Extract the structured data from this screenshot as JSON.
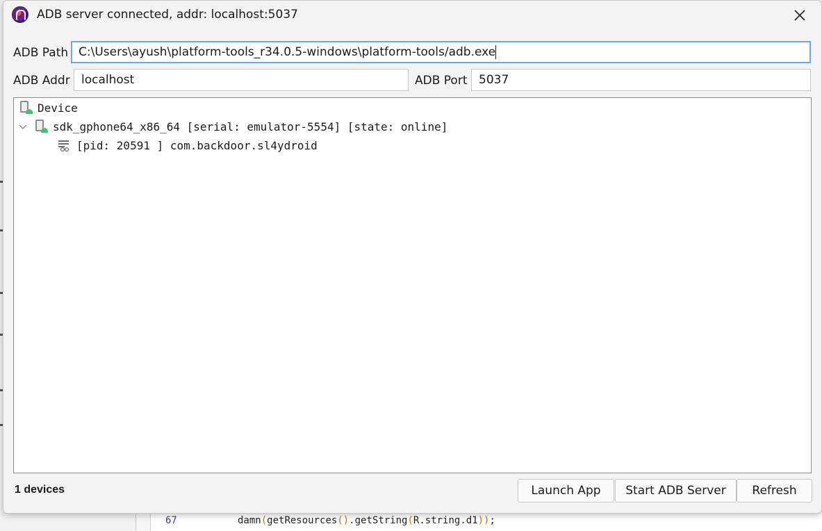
{
  "window": {
    "title": "ADB server connected, addr: localhost:5037"
  },
  "form": {
    "adb_path_label": "ADB Path",
    "adb_path_value": "C:\\Users\\ayush\\platform-tools_r34.0.5-windows\\platform-tools/adb.exe",
    "adb_addr_label": "ADB Addr",
    "adb_addr_value": "localhost",
    "adb_port_label": "ADB Port",
    "adb_port_value": "5037"
  },
  "tree": {
    "root_label": "Device",
    "device_label": "sdk_gphone64_x86_64 [serial: emulator-5554] [state: online]",
    "process_label": "[pid: 20591 ] com.backdoor.sl4ydroid"
  },
  "status": {
    "devices_count": "1 devices"
  },
  "buttons": {
    "launch_app": "Launch App",
    "start_adb_server": "Start ADB Server",
    "refresh": "Refresh"
  },
  "background": {
    "line_number": "67",
    "code": {
      "fn": "damn",
      "p1": "(",
      "call": "getResources",
      "p2": "()",
      "rest": ".getString",
      "p3": "(",
      "arg": "R.string.d1",
      "p4": "))",
      "end": ";"
    }
  },
  "colors": {
    "focus_border": "#6aa5ef",
    "android_green": "#3ec46d"
  }
}
